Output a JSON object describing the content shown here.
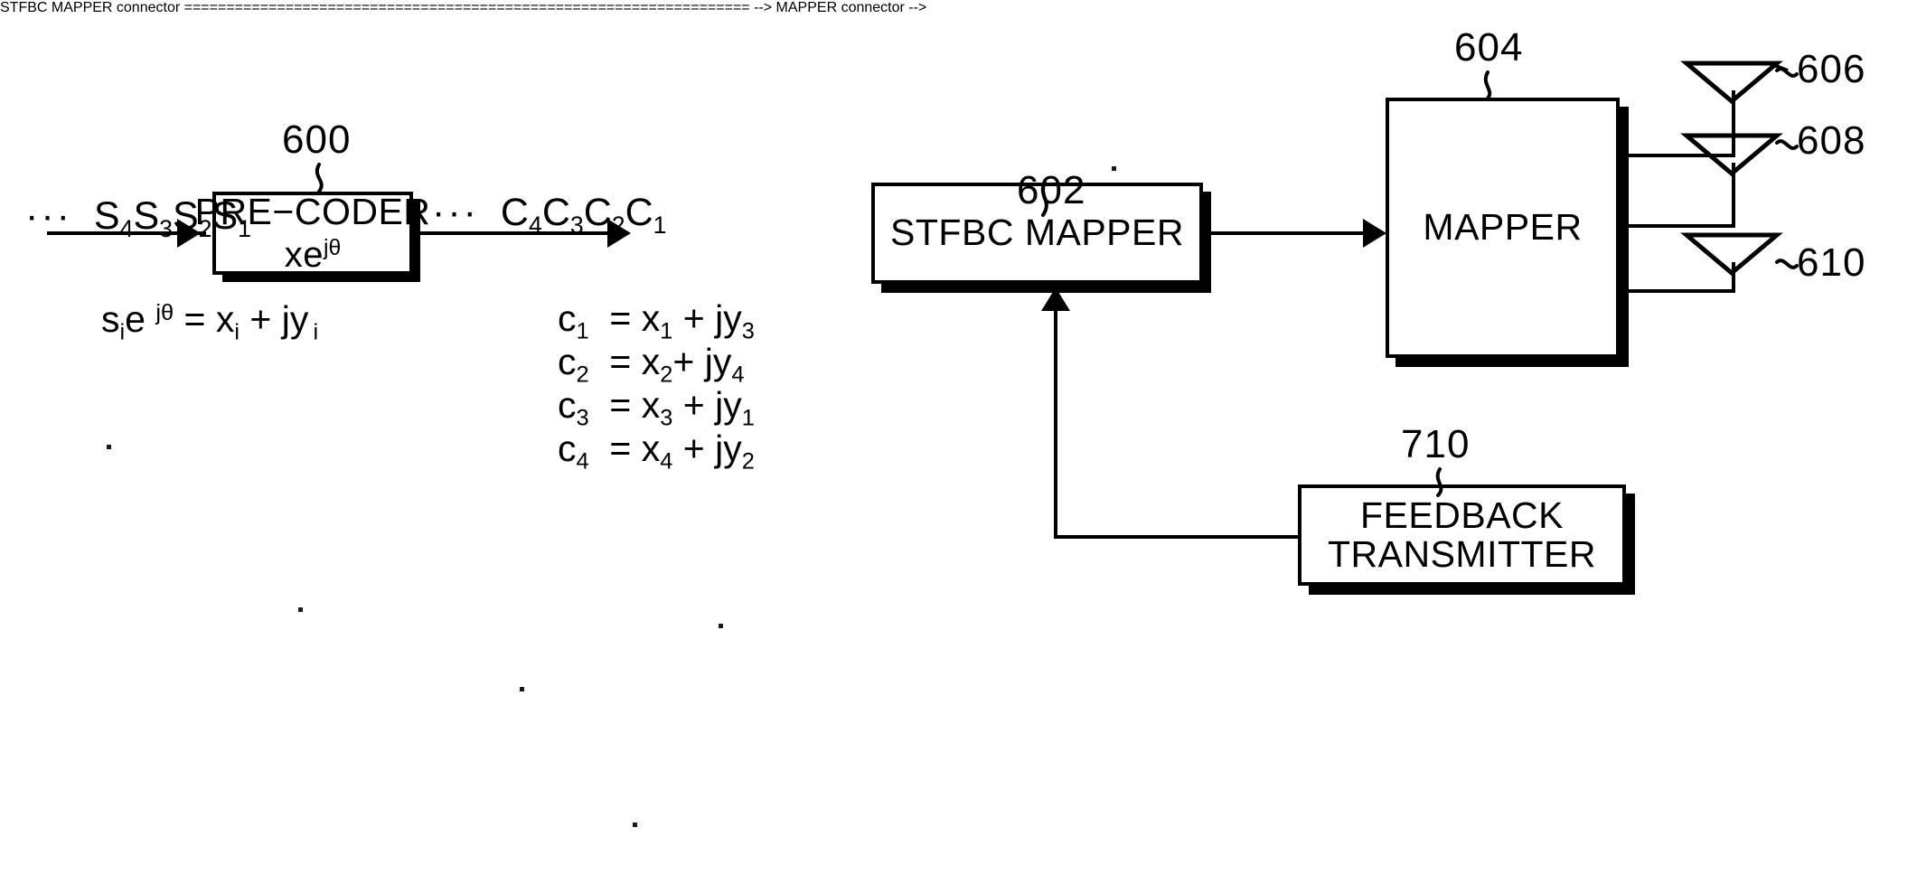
{
  "figure": {
    "type": "patent-block-diagram",
    "background": "#ffffff",
    "ink": "#000000"
  },
  "input_signal": {
    "dots": "···",
    "label": "S4S3S2S1",
    "terms": [
      "S",
      "4",
      "S",
      "3",
      "S",
      "2",
      "S",
      "1"
    ]
  },
  "precoder": {
    "ref": "600",
    "title": "PRE−CODER",
    "subtitle": "xe",
    "subtitle_exp": "jθ"
  },
  "precoder_formula": {
    "base": "s",
    "sub1": "i",
    "e": "e",
    "exp": "jθ",
    "rest": "= x",
    "sub2": "i",
    "plus": "+ jy",
    "sub3": "i",
    "full": "s i e jθ = x i + jy i"
  },
  "coded_signal": {
    "dots": "···",
    "label": "C4C3C2C1"
  },
  "c_equations": [
    {
      "lhs": "c",
      "lhs_sub": "1",
      "eq": "=",
      "x": "x",
      "x_sub": "1",
      "op": "+ jy",
      "y_sub": "3",
      "text": "c1 = x1 + jy3"
    },
    {
      "lhs": "c",
      "lhs_sub": "2",
      "eq": "=",
      "x": "x",
      "x_sub": "2",
      "op": "+ jy",
      "y_sub": "4",
      "text": "c2 = x2 + jy4"
    },
    {
      "lhs": "c",
      "lhs_sub": "3",
      "eq": "=",
      "x": "x",
      "x_sub": "3",
      "op": "+ jy",
      "y_sub": "1",
      "text": "c3 = x3 + jy1"
    },
    {
      "lhs": "c",
      "lhs_sub": "4",
      "eq": "=",
      "x": "x",
      "x_sub": "4",
      "op": "+ jy",
      "y_sub": "2",
      "text": "c4 = x4 + jy2"
    }
  ],
  "stfbc_mapper": {
    "ref": "602",
    "title": "STFBC MAPPER"
  },
  "mapper": {
    "ref": "604",
    "title": "MAPPER"
  },
  "feedback_transmitter": {
    "ref": "710",
    "title_line1": "FEEDBACK",
    "title_line2": "TRANSMITTER"
  },
  "antennas": [
    {
      "ref": "606",
      "name": "antenna-606"
    },
    {
      "ref": "608",
      "name": "antenna-608"
    },
    {
      "ref": "610",
      "name": "antenna-610"
    }
  ]
}
